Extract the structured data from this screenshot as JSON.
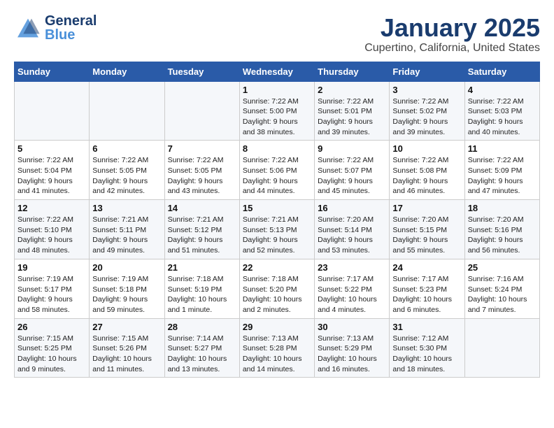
{
  "header": {
    "logo_general": "General",
    "logo_blue": "Blue",
    "month_title": "January 2025",
    "location": "Cupertino, California, United States"
  },
  "weekdays": [
    "Sunday",
    "Monday",
    "Tuesday",
    "Wednesday",
    "Thursday",
    "Friday",
    "Saturday"
  ],
  "weeks": [
    [
      {
        "day": "",
        "info": ""
      },
      {
        "day": "",
        "info": ""
      },
      {
        "day": "",
        "info": ""
      },
      {
        "day": "1",
        "info": "Sunrise: 7:22 AM\nSunset: 5:00 PM\nDaylight: 9 hours\nand 38 minutes."
      },
      {
        "day": "2",
        "info": "Sunrise: 7:22 AM\nSunset: 5:01 PM\nDaylight: 9 hours\nand 39 minutes."
      },
      {
        "day": "3",
        "info": "Sunrise: 7:22 AM\nSunset: 5:02 PM\nDaylight: 9 hours\nand 39 minutes."
      },
      {
        "day": "4",
        "info": "Sunrise: 7:22 AM\nSunset: 5:03 PM\nDaylight: 9 hours\nand 40 minutes."
      }
    ],
    [
      {
        "day": "5",
        "info": "Sunrise: 7:22 AM\nSunset: 5:04 PM\nDaylight: 9 hours\nand 41 minutes."
      },
      {
        "day": "6",
        "info": "Sunrise: 7:22 AM\nSunset: 5:05 PM\nDaylight: 9 hours\nand 42 minutes."
      },
      {
        "day": "7",
        "info": "Sunrise: 7:22 AM\nSunset: 5:05 PM\nDaylight: 9 hours\nand 43 minutes."
      },
      {
        "day": "8",
        "info": "Sunrise: 7:22 AM\nSunset: 5:06 PM\nDaylight: 9 hours\nand 44 minutes."
      },
      {
        "day": "9",
        "info": "Sunrise: 7:22 AM\nSunset: 5:07 PM\nDaylight: 9 hours\nand 45 minutes."
      },
      {
        "day": "10",
        "info": "Sunrise: 7:22 AM\nSunset: 5:08 PM\nDaylight: 9 hours\nand 46 minutes."
      },
      {
        "day": "11",
        "info": "Sunrise: 7:22 AM\nSunset: 5:09 PM\nDaylight: 9 hours\nand 47 minutes."
      }
    ],
    [
      {
        "day": "12",
        "info": "Sunrise: 7:22 AM\nSunset: 5:10 PM\nDaylight: 9 hours\nand 48 minutes."
      },
      {
        "day": "13",
        "info": "Sunrise: 7:21 AM\nSunset: 5:11 PM\nDaylight: 9 hours\nand 49 minutes."
      },
      {
        "day": "14",
        "info": "Sunrise: 7:21 AM\nSunset: 5:12 PM\nDaylight: 9 hours\nand 51 minutes."
      },
      {
        "day": "15",
        "info": "Sunrise: 7:21 AM\nSunset: 5:13 PM\nDaylight: 9 hours\nand 52 minutes."
      },
      {
        "day": "16",
        "info": "Sunrise: 7:20 AM\nSunset: 5:14 PM\nDaylight: 9 hours\nand 53 minutes."
      },
      {
        "day": "17",
        "info": "Sunrise: 7:20 AM\nSunset: 5:15 PM\nDaylight: 9 hours\nand 55 minutes."
      },
      {
        "day": "18",
        "info": "Sunrise: 7:20 AM\nSunset: 5:16 PM\nDaylight: 9 hours\nand 56 minutes."
      }
    ],
    [
      {
        "day": "19",
        "info": "Sunrise: 7:19 AM\nSunset: 5:17 PM\nDaylight: 9 hours\nand 58 minutes."
      },
      {
        "day": "20",
        "info": "Sunrise: 7:19 AM\nSunset: 5:18 PM\nDaylight: 9 hours\nand 59 minutes."
      },
      {
        "day": "21",
        "info": "Sunrise: 7:18 AM\nSunset: 5:19 PM\nDaylight: 10 hours\nand 1 minute."
      },
      {
        "day": "22",
        "info": "Sunrise: 7:18 AM\nSunset: 5:20 PM\nDaylight: 10 hours\nand 2 minutes."
      },
      {
        "day": "23",
        "info": "Sunrise: 7:17 AM\nSunset: 5:22 PM\nDaylight: 10 hours\nand 4 minutes."
      },
      {
        "day": "24",
        "info": "Sunrise: 7:17 AM\nSunset: 5:23 PM\nDaylight: 10 hours\nand 6 minutes."
      },
      {
        "day": "25",
        "info": "Sunrise: 7:16 AM\nSunset: 5:24 PM\nDaylight: 10 hours\nand 7 minutes."
      }
    ],
    [
      {
        "day": "26",
        "info": "Sunrise: 7:15 AM\nSunset: 5:25 PM\nDaylight: 10 hours\nand 9 minutes."
      },
      {
        "day": "27",
        "info": "Sunrise: 7:15 AM\nSunset: 5:26 PM\nDaylight: 10 hours\nand 11 minutes."
      },
      {
        "day": "28",
        "info": "Sunrise: 7:14 AM\nSunset: 5:27 PM\nDaylight: 10 hours\nand 13 minutes."
      },
      {
        "day": "29",
        "info": "Sunrise: 7:13 AM\nSunset: 5:28 PM\nDaylight: 10 hours\nand 14 minutes."
      },
      {
        "day": "30",
        "info": "Sunrise: 7:13 AM\nSunset: 5:29 PM\nDaylight: 10 hours\nand 16 minutes."
      },
      {
        "day": "31",
        "info": "Sunrise: 7:12 AM\nSunset: 5:30 PM\nDaylight: 10 hours\nand 18 minutes."
      },
      {
        "day": "",
        "info": ""
      }
    ]
  ]
}
